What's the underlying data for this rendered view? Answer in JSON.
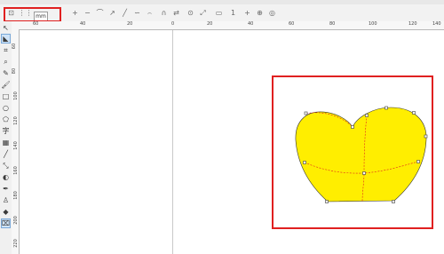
{
  "property_bar": {
    "units_value": "mm",
    "zoom_value": "1"
  },
  "ruler": {
    "h_labels": [
      "60",
      "40",
      "20",
      "0",
      "20",
      "40",
      "60",
      "80",
      "100",
      "120",
      "140"
    ],
    "v_labels": [
      "60",
      "80",
      "100",
      "120",
      "140",
      "160",
      "180",
      "200",
      "220"
    ]
  },
  "tools": [
    {
      "icon": "pick-tool-icon"
    },
    {
      "icon": "shape-tool-icon"
    },
    {
      "icon": "crop-tool-icon"
    },
    {
      "icon": "zoom-tool-icon"
    },
    {
      "icon": "freehand-tool-icon"
    },
    {
      "icon": "artistic-media-icon"
    },
    {
      "icon": "rectangle-tool-icon"
    },
    {
      "icon": "ellipse-tool-icon"
    },
    {
      "icon": "polygon-tool-icon"
    },
    {
      "icon": "text-tool-icon"
    },
    {
      "icon": "table-tool-icon"
    },
    {
      "icon": "dimension-tool-icon"
    },
    {
      "icon": "connector-tool-icon"
    },
    {
      "icon": "blend-tool-icon"
    },
    {
      "icon": "eyedropper-tool-icon"
    },
    {
      "icon": "outline-pen-icon"
    },
    {
      "icon": "fill-tool-icon"
    },
    {
      "icon": "interactive-fill-icon"
    }
  ],
  "heart": {
    "fill": "#ffee00",
    "node_color": "#555555",
    "curve_color": "#e02020"
  },
  "selection_box_color": "#e02020"
}
